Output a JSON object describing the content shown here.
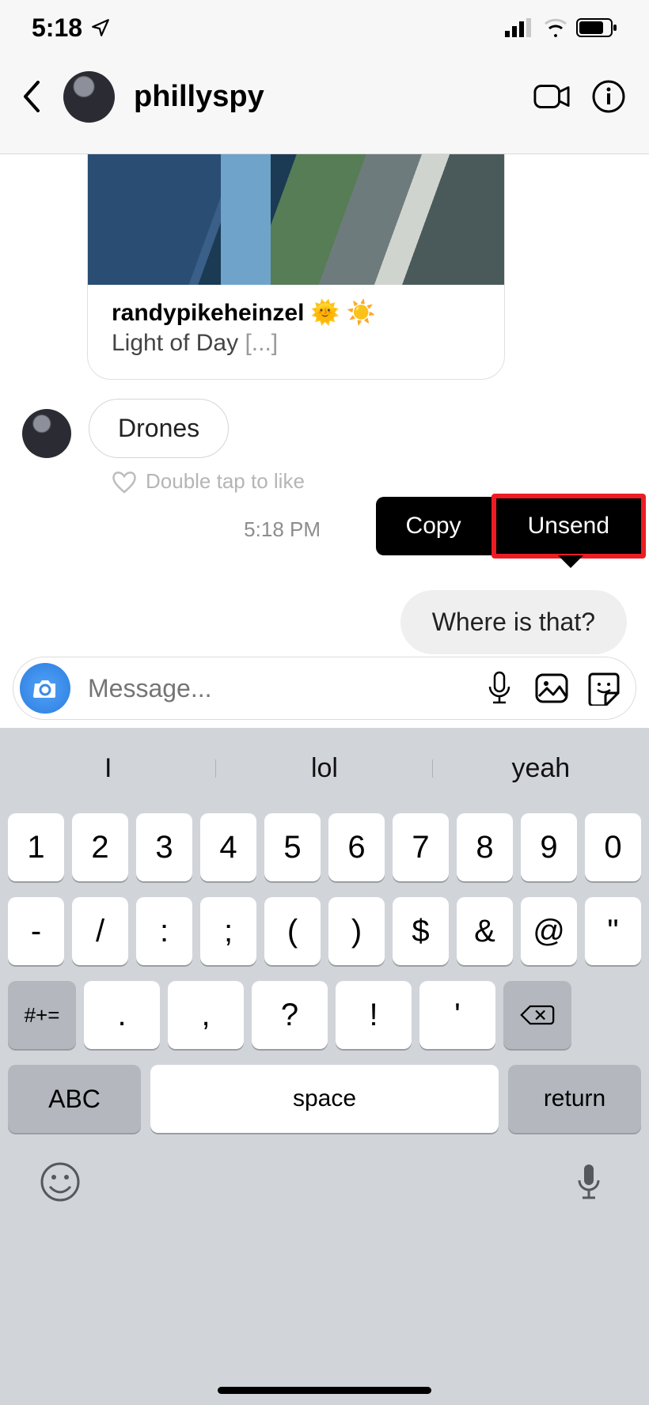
{
  "status": {
    "time": "5:18"
  },
  "header": {
    "username": "phillyspy"
  },
  "post": {
    "author": "randypikeheinzel",
    "emoji1": "🌞",
    "emoji2": "☀️",
    "caption_text": "Light of Day",
    "caption_more": "[...]"
  },
  "messages": {
    "incoming_1": "Drones",
    "like_hint": "Double tap to like",
    "timestamp": "5:18 PM",
    "outgoing_1": "Where is that?"
  },
  "context_menu": {
    "copy": "Copy",
    "unsend": "Unsend"
  },
  "compose": {
    "placeholder": "Message..."
  },
  "keyboard": {
    "suggestions": [
      "I",
      "lol",
      "yeah"
    ],
    "row1": [
      "1",
      "2",
      "3",
      "4",
      "5",
      "6",
      "7",
      "8",
      "9",
      "0"
    ],
    "row2": [
      "-",
      "/",
      ":",
      ";",
      "(",
      ")",
      "$",
      "&",
      "@",
      "\""
    ],
    "row3_mod": "#+=",
    "row3": [
      ".",
      ",",
      "?",
      "!",
      "'"
    ],
    "abc": "ABC",
    "space": "space",
    "return": "return"
  }
}
